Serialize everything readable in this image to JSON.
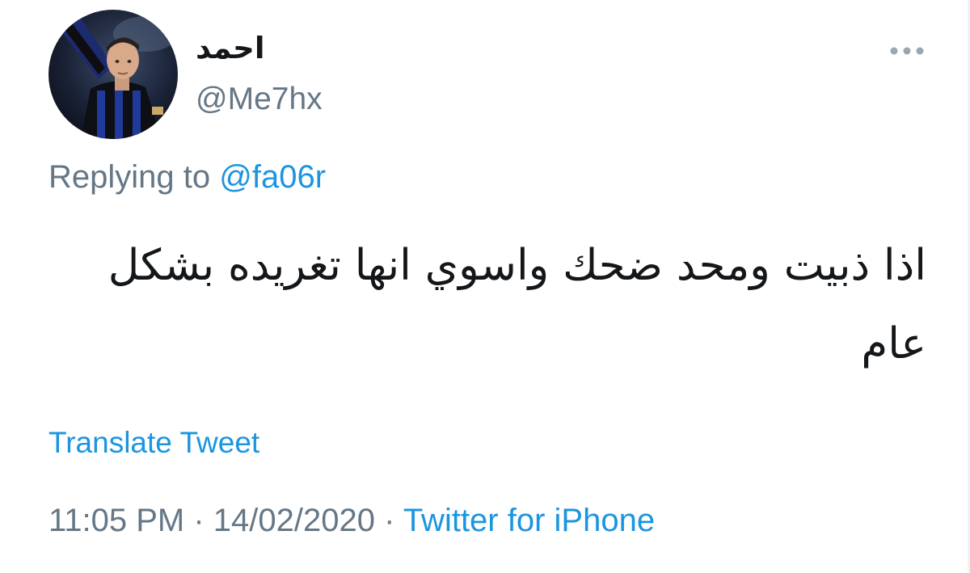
{
  "tweet": {
    "author": {
      "display_name": "احمد",
      "handle": "@Me7hx"
    },
    "replying_prefix": "Replying to",
    "replying_to": "@fa06r",
    "text": "اذا ذبيت ومحد ضحك واسوي انها تغريده بشكل عام",
    "translate_label": "Translate Tweet",
    "time": "11:05 PM",
    "separator": " · ",
    "date": "14/02/2020",
    "source": "Twitter for iPhone"
  },
  "icons": {
    "more": "more-horizontal-icon",
    "avatar": "profile-photo"
  },
  "colors": {
    "primary_text": "#14171a",
    "secondary_text": "#657786",
    "link": "#1b95e0",
    "background": "#ffffff"
  }
}
